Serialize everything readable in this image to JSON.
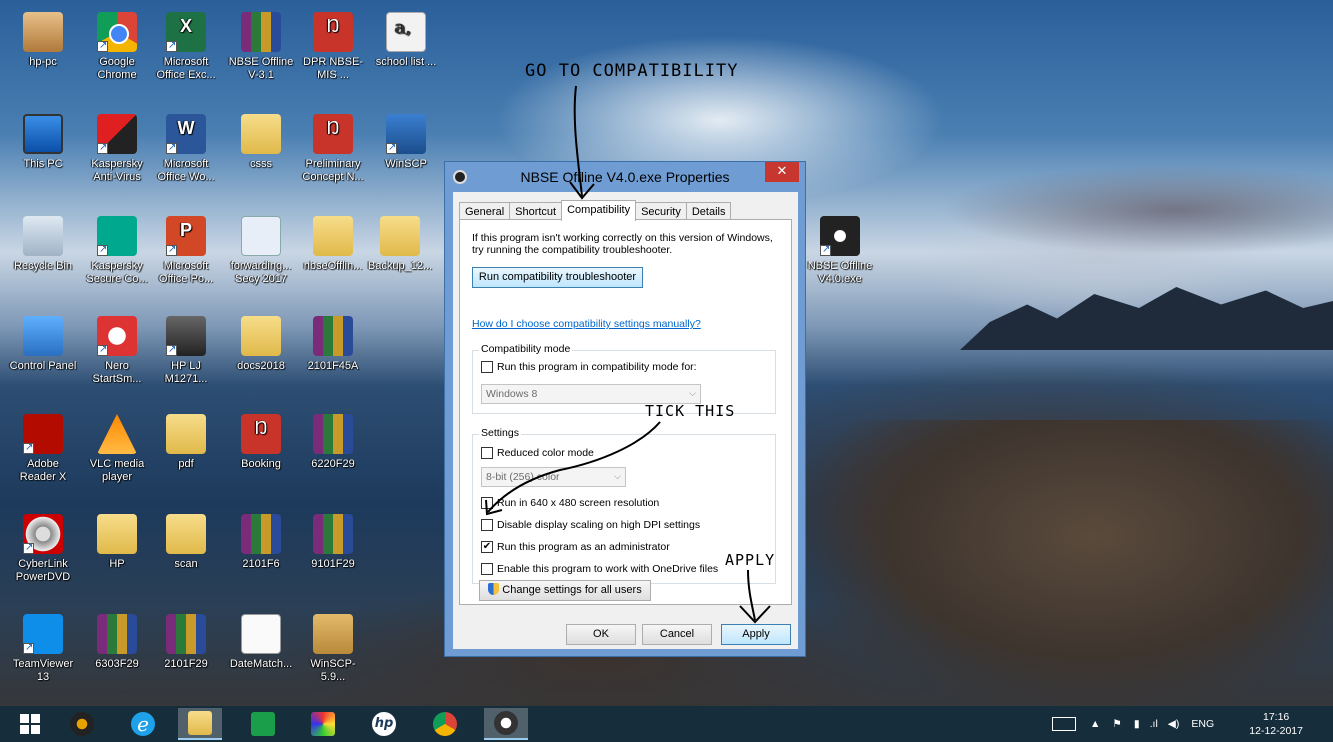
{
  "desktop": {
    "icons": [
      {
        "label": "hp-pc",
        "icon": "user-folder-icon"
      },
      {
        "label": "Google Chrome",
        "icon": "chrome-icon"
      },
      {
        "label": "Microsoft Office Exc...",
        "icon": "excel-icon"
      },
      {
        "label": "NBSE Offline V-3.1",
        "icon": "winrar-archive-icon"
      },
      {
        "label": "DPR NBSE-MIS ...",
        "icon": "pdf-icon"
      },
      {
        "label": "school list ...",
        "icon": "document-icon"
      },
      {
        "label": "This PC",
        "icon": "computer-icon"
      },
      {
        "label": "Kaspersky Anti-Virus",
        "icon": "kaspersky-icon"
      },
      {
        "label": "Microsoft Office Wo...",
        "icon": "word-icon"
      },
      {
        "label": "csss",
        "icon": "folder-icon"
      },
      {
        "label": "Preliminary Concept N...",
        "icon": "pdf-icon"
      },
      {
        "label": "WinSCP",
        "icon": "winscp-icon"
      },
      {
        "label": "Recycle Bin",
        "icon": "recycle-bin-icon"
      },
      {
        "label": "Kaspersky Secure Co...",
        "icon": "kaspersky-secure-icon"
      },
      {
        "label": "Microsoft Office Po...",
        "icon": "powerpoint-icon"
      },
      {
        "label": "forwarding... Secy 2017",
        "icon": "word-document-icon"
      },
      {
        "label": "nbseOfflin...",
        "icon": "folder-icon"
      },
      {
        "label": "Backup_12...",
        "icon": "folder-icon"
      },
      {
        "label": "NBSE Offline V4.0.exe",
        "icon": "nbse-app-icon"
      },
      {
        "label": "Control Panel",
        "icon": "control-panel-icon"
      },
      {
        "label": "Nero StartSm...",
        "icon": "nero-icon"
      },
      {
        "label": "HP LJ M1271...",
        "icon": "scanner-icon"
      },
      {
        "label": "docs2018",
        "icon": "folder-icon"
      },
      {
        "label": "2101F45A",
        "icon": "winrar-archive-icon"
      },
      {
        "label": "Adobe Reader X",
        "icon": "adobe-reader-icon"
      },
      {
        "label": "VLC media player",
        "icon": "vlc-icon"
      },
      {
        "label": "pdf",
        "icon": "folder-icon"
      },
      {
        "label": "Booking",
        "icon": "pdf-icon"
      },
      {
        "label": "6220F29",
        "icon": "winrar-archive-icon"
      },
      {
        "label": "CyberLink PowerDVD",
        "icon": "powerdvd-icon"
      },
      {
        "label": "HP",
        "icon": "folder-icon"
      },
      {
        "label": "scan",
        "icon": "folder-icon"
      },
      {
        "label": "2101F6",
        "icon": "winrar-archive-icon"
      },
      {
        "label": "9101F29",
        "icon": "winrar-archive-icon"
      },
      {
        "label": "TeamViewer 13",
        "icon": "teamviewer-icon"
      },
      {
        "label": "6303F29",
        "icon": "winrar-archive-icon"
      },
      {
        "label": "2101F29",
        "icon": "winrar-archive-icon"
      },
      {
        "label": "DateMatch...",
        "icon": "text-file-icon"
      },
      {
        "label": "WinSCP-5.9...",
        "icon": "installer-package-icon"
      }
    ]
  },
  "annotations": {
    "go_to": "GO TO COMPATIBILITY",
    "tick": "TICK THIS",
    "apply": "APPLY"
  },
  "dialog": {
    "title": "NBSE Offline V4.0.exe Properties",
    "close_glyph": "✕",
    "tabs": [
      "General",
      "Shortcut",
      "Compatibility",
      "Security",
      "Details"
    ],
    "active_tab": "Compatibility",
    "intro": "If this program isn't working correctly on this version of Windows, try running the compatibility troubleshooter.",
    "troubleshooter_button": "Run compatibility troubleshooter",
    "help_link": "How do I choose compatibility settings manually?",
    "compat_mode": {
      "title": "Compatibility mode",
      "checkbox": "Run this program in compatibility mode for:",
      "checked": false,
      "select_value": "Windows 8"
    },
    "settings": {
      "title": "Settings",
      "reduced_color": {
        "label": "Reduced color mode",
        "checked": false
      },
      "color_select": "8-bit (256) color",
      "res_640": {
        "label": "Run in 640 x 480 screen resolution",
        "checked": false
      },
      "dpi": {
        "label": "Disable display scaling on high DPI settings",
        "checked": false
      },
      "admin": {
        "label": "Run this program as an administrator",
        "checked": true
      },
      "onedrive": {
        "label": "Enable this program to work with OneDrive files",
        "checked": false
      }
    },
    "change_all_button": "Change settings for all users",
    "ok": "OK",
    "cancel": "Cancel",
    "apply": "Apply",
    "check_glyph": "✔"
  },
  "taskbar": {
    "items": [
      "windows-start-icon",
      "media-player-icon",
      "internet-explorer-icon",
      "file-explorer-icon",
      "store-icon",
      "paint-app-icon",
      "hp-icon",
      "chrome-icon",
      "nbse-app-icon"
    ],
    "active_item": "file-explorer-icon",
    "language": "ENG",
    "time": "17:16",
    "date": "12-12-2017"
  },
  "colors": {
    "dialog_frame": "#6f9dd3",
    "close_red": "#c7372f",
    "link_blue": "#0066cc",
    "taskbar": "#142d3c"
  }
}
